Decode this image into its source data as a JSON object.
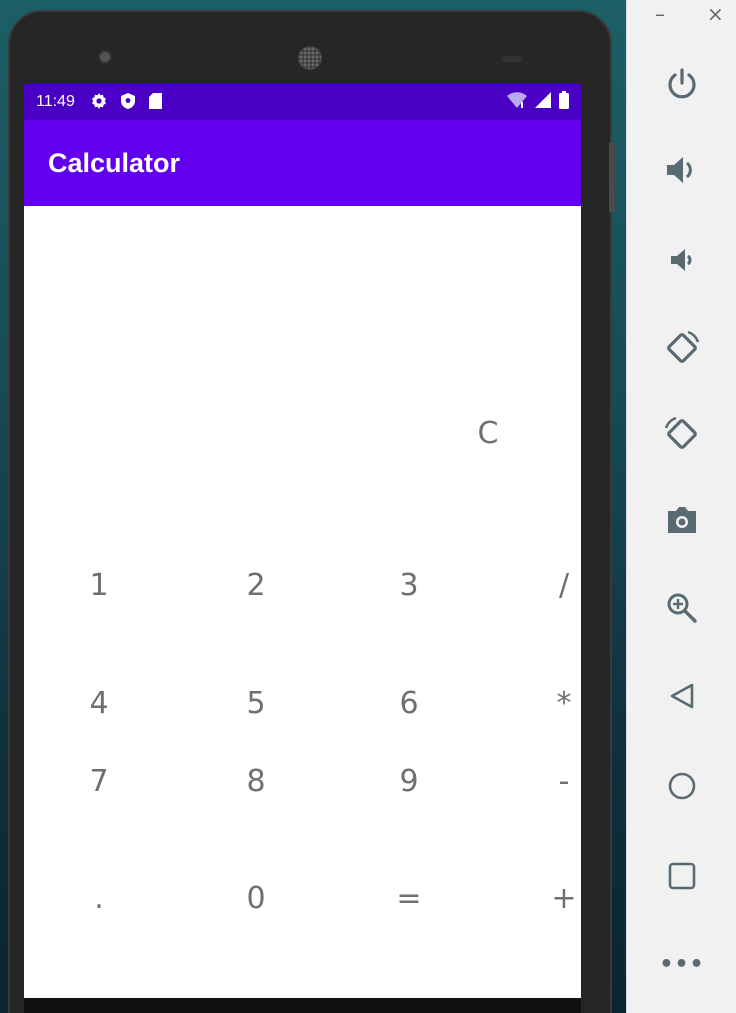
{
  "status_bar": {
    "time": "11:49",
    "icons": [
      "gear-icon",
      "shield-icon",
      "sd-card-icon"
    ],
    "right_icons": [
      "wifi-icon",
      "signal-icon",
      "battery-icon"
    ],
    "color": "#4a00c4"
  },
  "app_bar": {
    "title": "Calculator",
    "color": "#6200ee"
  },
  "calculator": {
    "clear_label": "C",
    "rows": [
      [
        "1",
        "2",
        "3",
        "/"
      ],
      [
        "4",
        "5",
        "6",
        "*"
      ],
      [
        "7",
        "8",
        "9",
        "-"
      ],
      [
        ".",
        "0",
        "=",
        "+"
      ]
    ],
    "key_color": "#6f6f6f"
  },
  "toolbar": {
    "minimize_label": "–",
    "close_label": "×",
    "buttons": [
      "power-icon",
      "volume-up-icon",
      "volume-down-icon",
      "rotate-left-icon",
      "rotate-right-icon",
      "camera-icon",
      "zoom-icon",
      "back-icon",
      "home-icon",
      "overview-icon",
      "more-icon"
    ],
    "more_label": "•••"
  }
}
